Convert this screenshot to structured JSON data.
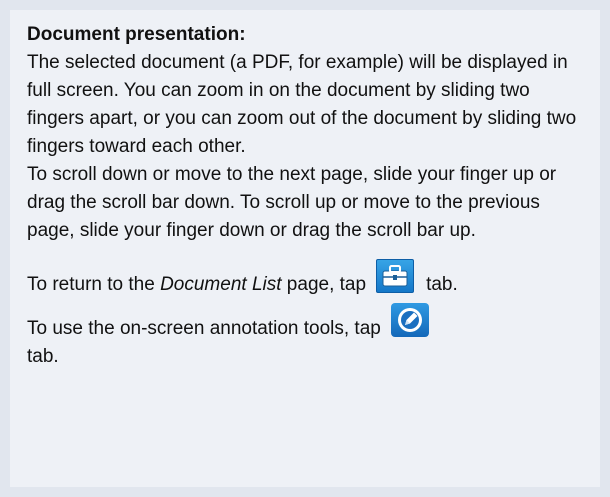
{
  "heading": "Document presentation:",
  "paragraph1": "The selected document (a PDF, for example) will be displayed in full screen. You can zoom in on the document by sliding two fingers apart, or you can zoom out of the document by sliding two fingers toward each other.",
  "paragraph2": "To scroll down or move to the next page, slide your finger up or drag the scroll bar down. To scroll up or move to the previous page, slide your finger down or drag the scroll bar up.",
  "return_line": {
    "prefix": "To return to the ",
    "emphasis": "Document List",
    "middle": " page, tap",
    "suffix": "tab."
  },
  "annotate_line": {
    "prefix": "To use the on-screen annotation tools, tap",
    "suffix": "tab."
  },
  "icons": {
    "return_icon": "toolbox-icon",
    "annotate_icon": "pencil-circle-icon"
  },
  "colors": {
    "page_background": "#e1e6ee",
    "panel_background": "#eef1f6",
    "icon_blue": "#1a7fd0"
  }
}
